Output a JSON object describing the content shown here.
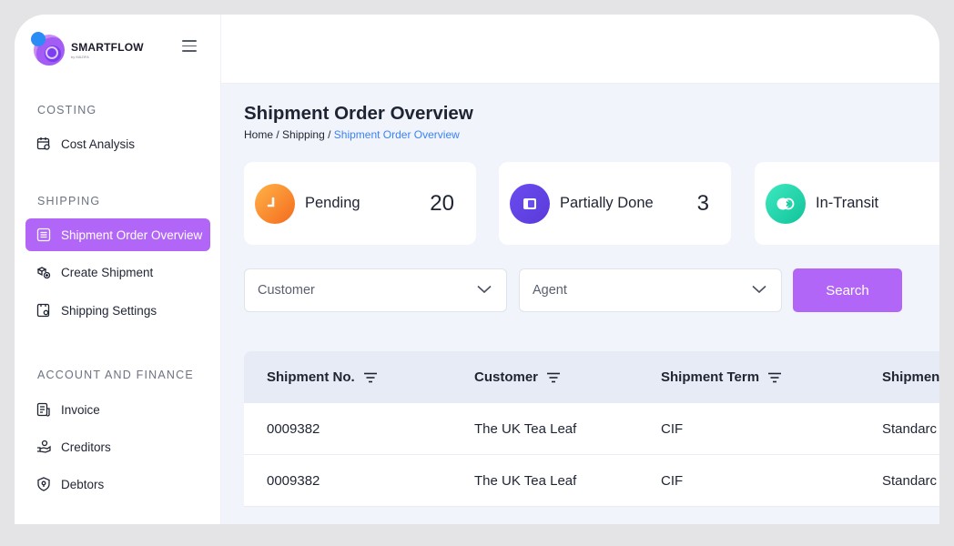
{
  "brand": {
    "name": "SMARTFLOW",
    "tagline": "by MAZIFA"
  },
  "sidebar": {
    "sections": [
      {
        "title": "COSTING"
      },
      {
        "title": "SHIPPING"
      },
      {
        "title": "ACCOUNT AND FINANCE"
      }
    ],
    "items": [
      {
        "label": "Cost Analysis",
        "icon": "calendar-settings-icon"
      },
      {
        "label": "Shipment Order Overview",
        "icon": "list-icon",
        "active": true
      },
      {
        "label": "Create Shipment",
        "icon": "boxes-plus-icon"
      },
      {
        "label": "Shipping Settings",
        "icon": "gear-doc-icon"
      },
      {
        "label": "Invoice",
        "icon": "invoice-icon"
      },
      {
        "label": "Creditors",
        "icon": "hand-coins-icon"
      },
      {
        "label": "Debtors",
        "icon": "shield-dollar-icon"
      }
    ]
  },
  "page": {
    "title": "Shipment Order Overview",
    "breadcrumb": {
      "home": "Home",
      "sep": " / ",
      "section": "Shipping",
      "current": "Shipment Order Overview"
    }
  },
  "cards": [
    {
      "label": "Pending",
      "count": "20",
      "icon": "pending-icon",
      "color_from": "#ffb347",
      "color_to": "#f46a1e"
    },
    {
      "label": "Partially Done",
      "count": "3",
      "icon": "half-square-icon",
      "color_from": "#6a4cf0",
      "color_to": "#5a3ad8"
    },
    {
      "label": "In-Transit",
      "count": "",
      "icon": "transit-icon",
      "color_from": "#3ee8c0",
      "color_to": "#10c39a"
    }
  ],
  "filters": {
    "customer_placeholder": "Customer",
    "agent_placeholder": "Agent",
    "search_label": "Search"
  },
  "table": {
    "columns": [
      "Shipment No.",
      "Customer",
      "Shipment Term",
      "Shipmen"
    ],
    "rows": [
      [
        "0009382",
        "The UK Tea Leaf",
        "CIF",
        "Standarc"
      ],
      [
        "0009382",
        "The UK Tea Leaf",
        "CIF",
        "Standarc"
      ]
    ]
  },
  "colors": {
    "accent": "#b266f7",
    "breadcrumb_current": "#3b82f6",
    "main_bg": "#f1f4fb"
  }
}
